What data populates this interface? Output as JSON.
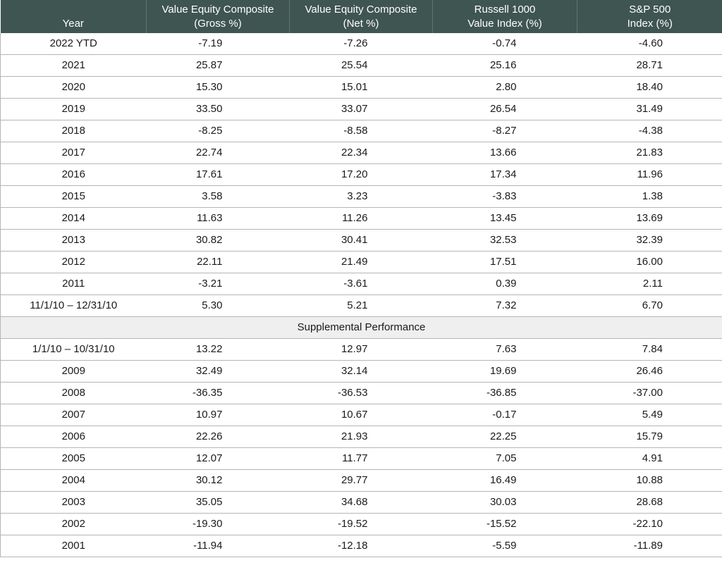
{
  "table": {
    "headers": {
      "year": "Year",
      "gross_line1": "Value Equity Composite",
      "gross_line2": "(Gross %)",
      "net_line1": "Value Equity Composite",
      "net_line2": "(Net %)",
      "russell_line1": "Russell 1000",
      "russell_line2": "Value Index (%)",
      "sp_line1": "S&P 500",
      "sp_line2": "Index (%)"
    },
    "rows_primary": [
      [
        "2022 YTD",
        "-7.19",
        "-7.26",
        "-0.74",
        "-4.60"
      ],
      [
        "2021",
        "25.87",
        "25.54",
        "25.16",
        "28.71"
      ],
      [
        "2020",
        "15.30",
        "15.01",
        "2.80",
        "18.40"
      ],
      [
        "2019",
        "33.50",
        "33.07",
        "26.54",
        "31.49"
      ],
      [
        "2018",
        "-8.25",
        "-8.58",
        "-8.27",
        "-4.38"
      ],
      [
        "2017",
        "22.74",
        "22.34",
        "13.66",
        "21.83"
      ],
      [
        "2016",
        "17.61",
        "17.20",
        "17.34",
        "11.96"
      ],
      [
        "2015",
        "3.58",
        "3.23",
        "-3.83",
        "1.38"
      ],
      [
        "2014",
        "11.63",
        "11.26",
        "13.45",
        "13.69"
      ],
      [
        "2013",
        "30.82",
        "30.41",
        "32.53",
        "32.39"
      ],
      [
        "2012",
        "22.11",
        "21.49",
        "17.51",
        "16.00"
      ],
      [
        "2011",
        "-3.21",
        "-3.61",
        "0.39",
        "2.11"
      ],
      [
        "11/1/10 – 12/31/10",
        "5.30",
        "5.21",
        "7.32",
        "6.70"
      ]
    ],
    "section_label": "Supplemental Performance",
    "rows_supplemental": [
      [
        "1/1/10 – 10/31/10",
        "13.22",
        "12.97",
        "7.63",
        "7.84"
      ],
      [
        "2009",
        "32.49",
        "32.14",
        "19.69",
        "26.46"
      ],
      [
        "2008",
        "-36.35",
        "-36.53",
        "-36.85",
        "-37.00"
      ],
      [
        "2007",
        "10.97",
        "10.67",
        "-0.17",
        "5.49"
      ],
      [
        "2006",
        "22.26",
        "21.93",
        "22.25",
        "15.79"
      ],
      [
        "2005",
        "12.07",
        "11.77",
        "7.05",
        "4.91"
      ],
      [
        "2004",
        "30.12",
        "29.77",
        "16.49",
        "10.88"
      ],
      [
        "2003",
        "35.05",
        "34.68",
        "30.03",
        "28.68"
      ],
      [
        "2002",
        "-19.30",
        "-19.52",
        "-15.52",
        "-22.10"
      ],
      [
        "2001",
        "-11.94",
        "-12.18",
        "-5.59",
        "-11.89"
      ]
    ]
  },
  "colors": {
    "header_bg": "#3f5552",
    "header_text": "#ffffff",
    "section_bg": "#efefef",
    "row_border": "#b5b5b5"
  }
}
